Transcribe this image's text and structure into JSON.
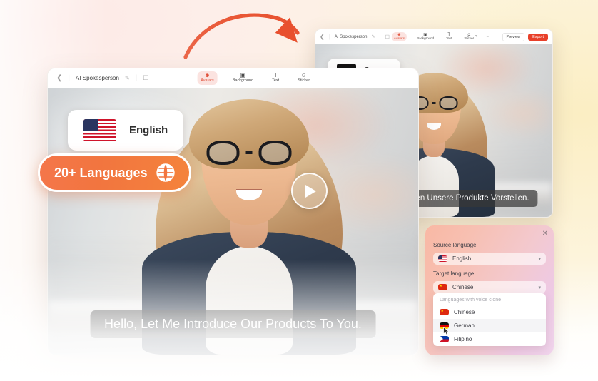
{
  "background": {
    "accent_orange": "#f2753f",
    "arrow_color": "#e8502e",
    "gradient_note": "soft pink to cream"
  },
  "arrow": {
    "name": "curved-arrow",
    "color": "#e8502e"
  },
  "main_editor": {
    "titlebar": {
      "back_icon": "chevron-left",
      "title": "AI Spokesperson",
      "edit_icon": "pencil",
      "save_icon": "save"
    },
    "tools": [
      {
        "label": "Avatars",
        "icon": "avatar-icon",
        "active": true
      },
      {
        "label": "Background",
        "icon": "image-icon",
        "active": false
      },
      {
        "label": "Text",
        "icon": "text-icon",
        "active": false
      },
      {
        "label": "Sticker",
        "icon": "sticker-icon",
        "active": false
      }
    ],
    "language_chip": {
      "label": "English",
      "flag": "us-flag"
    },
    "badge": {
      "label": "20+ Languages",
      "icon": "globe-icon"
    },
    "caption": "Hello,  Let Me Introduce Our Products To You.",
    "play_button": "play-icon"
  },
  "preview_window": {
    "titlebar": {
      "back_icon": "chevron-left",
      "title": "AI Spokesperson",
      "edit_icon": "pencil",
      "save_icon": "save"
    },
    "tools": [
      {
        "label": "Avatars",
        "icon": "avatar-icon",
        "active": true
      },
      {
        "label": "Background",
        "icon": "image-icon",
        "active": false
      },
      {
        "label": "Text",
        "icon": "text-icon",
        "active": false
      },
      {
        "label": "Sticker",
        "icon": "sticker-icon",
        "active": false
      }
    ],
    "actions": {
      "undo_icon": "undo-icon",
      "redo_icon": "redo-icon",
      "zoom_out_icon": "zoom-out-icon",
      "zoom_level": "",
      "zoom_in_icon": "zoom-in-icon",
      "preview_label": "Preview",
      "export_label": "Export",
      "export_color": "#e8402a"
    },
    "language_chip": {
      "label": "German",
      "flag": "de-flag"
    },
    "caption": "Hallo, Ich Möchte Ihnen Unsere Produkte Vorstellen."
  },
  "language_panel": {
    "close_icon": "close-icon",
    "source_label": "Source language",
    "source_value": "English",
    "source_flag": "us-flag",
    "target_label": "Target language",
    "target_value": "Chinese",
    "target_flag": "cn-flag",
    "dropdown_header": "Languages with voice clone",
    "options": [
      {
        "label": "Chinese",
        "flag": "cn-flag",
        "hovered": false
      },
      {
        "label": "German",
        "flag": "de-flag",
        "hovered": true
      },
      {
        "label": "Filipino",
        "flag": "ph-flag",
        "hovered": false
      }
    ],
    "chevron_icon": "chevron-down-icon"
  }
}
